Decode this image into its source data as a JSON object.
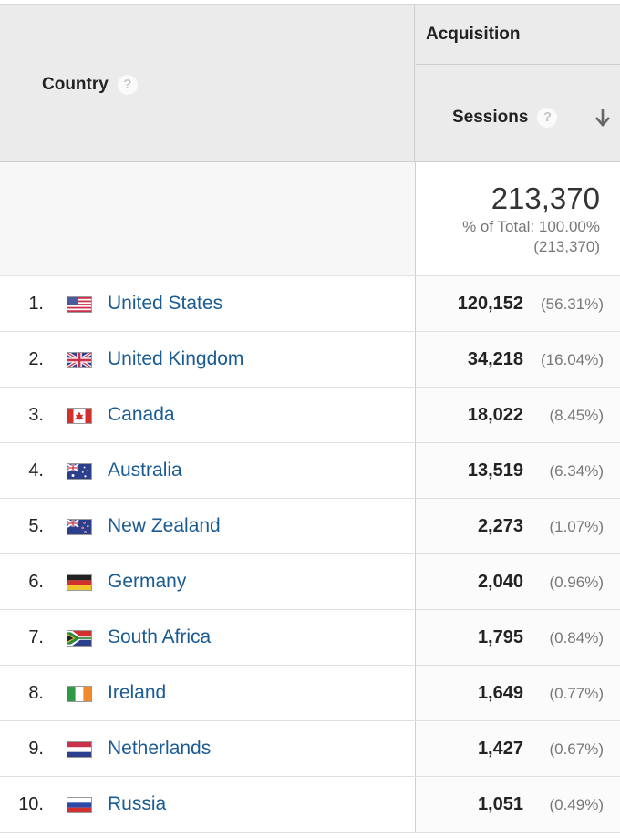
{
  "header": {
    "country_label": "Country",
    "group_label": "Acquisition",
    "sessions_label": "Sessions",
    "help_glyph": "?"
  },
  "totals": {
    "value": "213,370",
    "pct_label": "% of Total: 100.00%",
    "abs_label": "(213,370)"
  },
  "icons": {
    "help": "help-icon",
    "sort": "arrow-down-icon"
  },
  "colors": {
    "link": "#1a5b93",
    "header_bg": "#ebebeb"
  },
  "rows": [
    {
      "index": "1.",
      "country": "United States",
      "flag": "us-flag-icon",
      "sessions": "120,152",
      "pct": "(56.31%)"
    },
    {
      "index": "2.",
      "country": "United Kingdom",
      "flag": "uk-flag-icon",
      "sessions": "34,218",
      "pct": "(16.04%)"
    },
    {
      "index": "3.",
      "country": "Canada",
      "flag": "canada-flag-icon",
      "sessions": "18,022",
      "pct": "(8.45%)"
    },
    {
      "index": "4.",
      "country": "Australia",
      "flag": "australia-flag-icon",
      "sessions": "13,519",
      "pct": "(6.34%)"
    },
    {
      "index": "5.",
      "country": "New Zealand",
      "flag": "new-zealand-flag-icon",
      "sessions": "2,273",
      "pct": "(1.07%)"
    },
    {
      "index": "6.",
      "country": "Germany",
      "flag": "germany-flag-icon",
      "sessions": "2,040",
      "pct": "(0.96%)"
    },
    {
      "index": "7.",
      "country": "South Africa",
      "flag": "south-africa-flag-icon",
      "sessions": "1,795",
      "pct": "(0.84%)"
    },
    {
      "index": "8.",
      "country": "Ireland",
      "flag": "ireland-flag-icon",
      "sessions": "1,649",
      "pct": "(0.77%)"
    },
    {
      "index": "9.",
      "country": "Netherlands",
      "flag": "netherlands-flag-icon",
      "sessions": "1,427",
      "pct": "(0.67%)"
    },
    {
      "index": "10.",
      "country": "Russia",
      "flag": "russia-flag-icon",
      "sessions": "1,051",
      "pct": "(0.49%)"
    }
  ]
}
